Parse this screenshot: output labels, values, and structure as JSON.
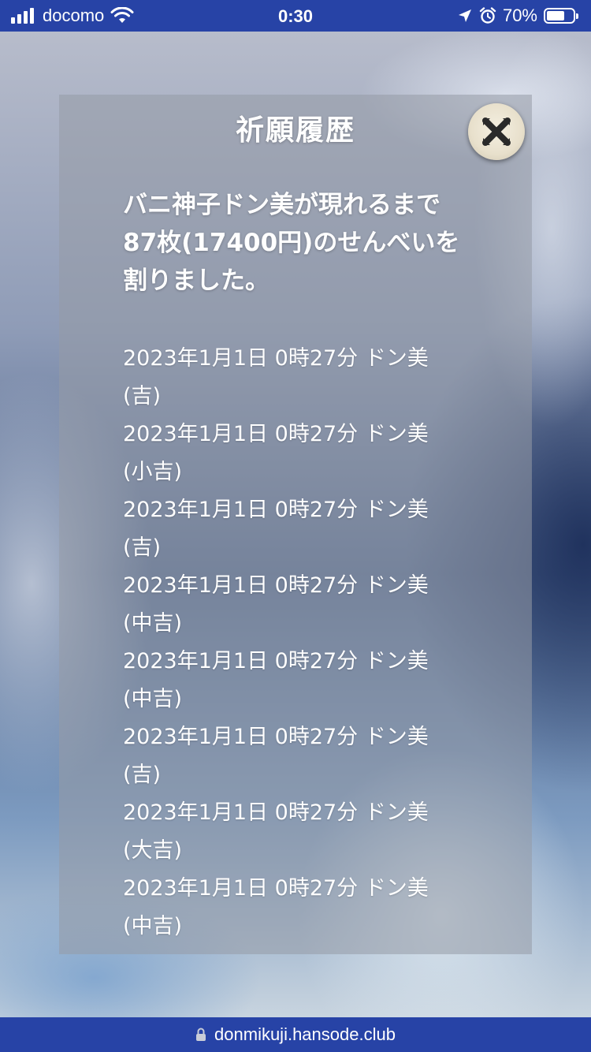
{
  "status_bar": {
    "carrier": "docomo",
    "time": "0:30",
    "battery": "70%",
    "battery_level": 0.7,
    "icons": [
      "signal-icon",
      "wifi-icon",
      "location-arrow-icon",
      "alarm-clock-icon",
      "battery-icon"
    ]
  },
  "modal": {
    "title": "祈願履歴",
    "close_icon": "close-x-icon",
    "summary": "バニ神子ドン美が現れるまで87枚(17400円)のせんべいを割りました。",
    "history": [
      {
        "datetime": "2023年1月1日 0時27分",
        "name": "ドン美",
        "fortune": "吉"
      },
      {
        "datetime": "2023年1月1日 0時27分",
        "name": "ドン美",
        "fortune": "小吉"
      },
      {
        "datetime": "2023年1月1日 0時27分",
        "name": "ドン美",
        "fortune": "吉"
      },
      {
        "datetime": "2023年1月1日 0時27分",
        "name": "ドン美",
        "fortune": "中吉"
      },
      {
        "datetime": "2023年1月1日 0時27分",
        "name": "ドン美",
        "fortune": "中吉"
      },
      {
        "datetime": "2023年1月1日 0時27分",
        "name": "ドン美",
        "fortune": "吉"
      },
      {
        "datetime": "2023年1月1日 0時27分",
        "name": "ドン美",
        "fortune": "大吉"
      },
      {
        "datetime": "2023年1月1日 0時27分",
        "name": "ドン美",
        "fortune": "中吉"
      }
    ]
  },
  "browser": {
    "url": "donmikuji.hansode.club"
  },
  "colors": {
    "bar_blue": "#2743a6",
    "text": "#ffffff"
  }
}
